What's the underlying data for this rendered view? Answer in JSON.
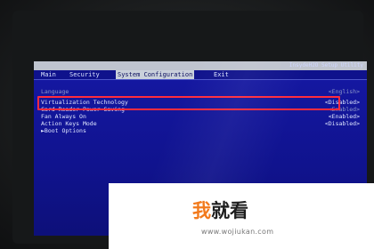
{
  "bios": {
    "utility_title": "InsydeH2O Setup Utility",
    "tabs": [
      {
        "label": "Main",
        "active": false
      },
      {
        "label": "Security",
        "active": false
      },
      {
        "label": "System Configuration",
        "active": true
      },
      {
        "label": "Exit",
        "active": false
      }
    ],
    "items": [
      {
        "label": "Language",
        "value": "<English>"
      },
      {
        "label": "Virtualization Technology",
        "value": "<Disabled>",
        "highlighted": true
      },
      {
        "label": "Card Reader Power Saving",
        "value": "<Enabled>"
      },
      {
        "label": "Fan Always On",
        "value": "<Enabled>"
      },
      {
        "label": "Action Keys Mode",
        "value": "<Disabled>"
      },
      {
        "label": "►Boot Options",
        "value": ""
      }
    ],
    "colors": {
      "background": "#11148a",
      "highlight_border": "#ff2c3e",
      "active_tab": "#c9d0db"
    }
  },
  "watermark": {
    "logo_part1": "我",
    "logo_part2": "就看",
    "url": "www.wojiukan.com"
  }
}
